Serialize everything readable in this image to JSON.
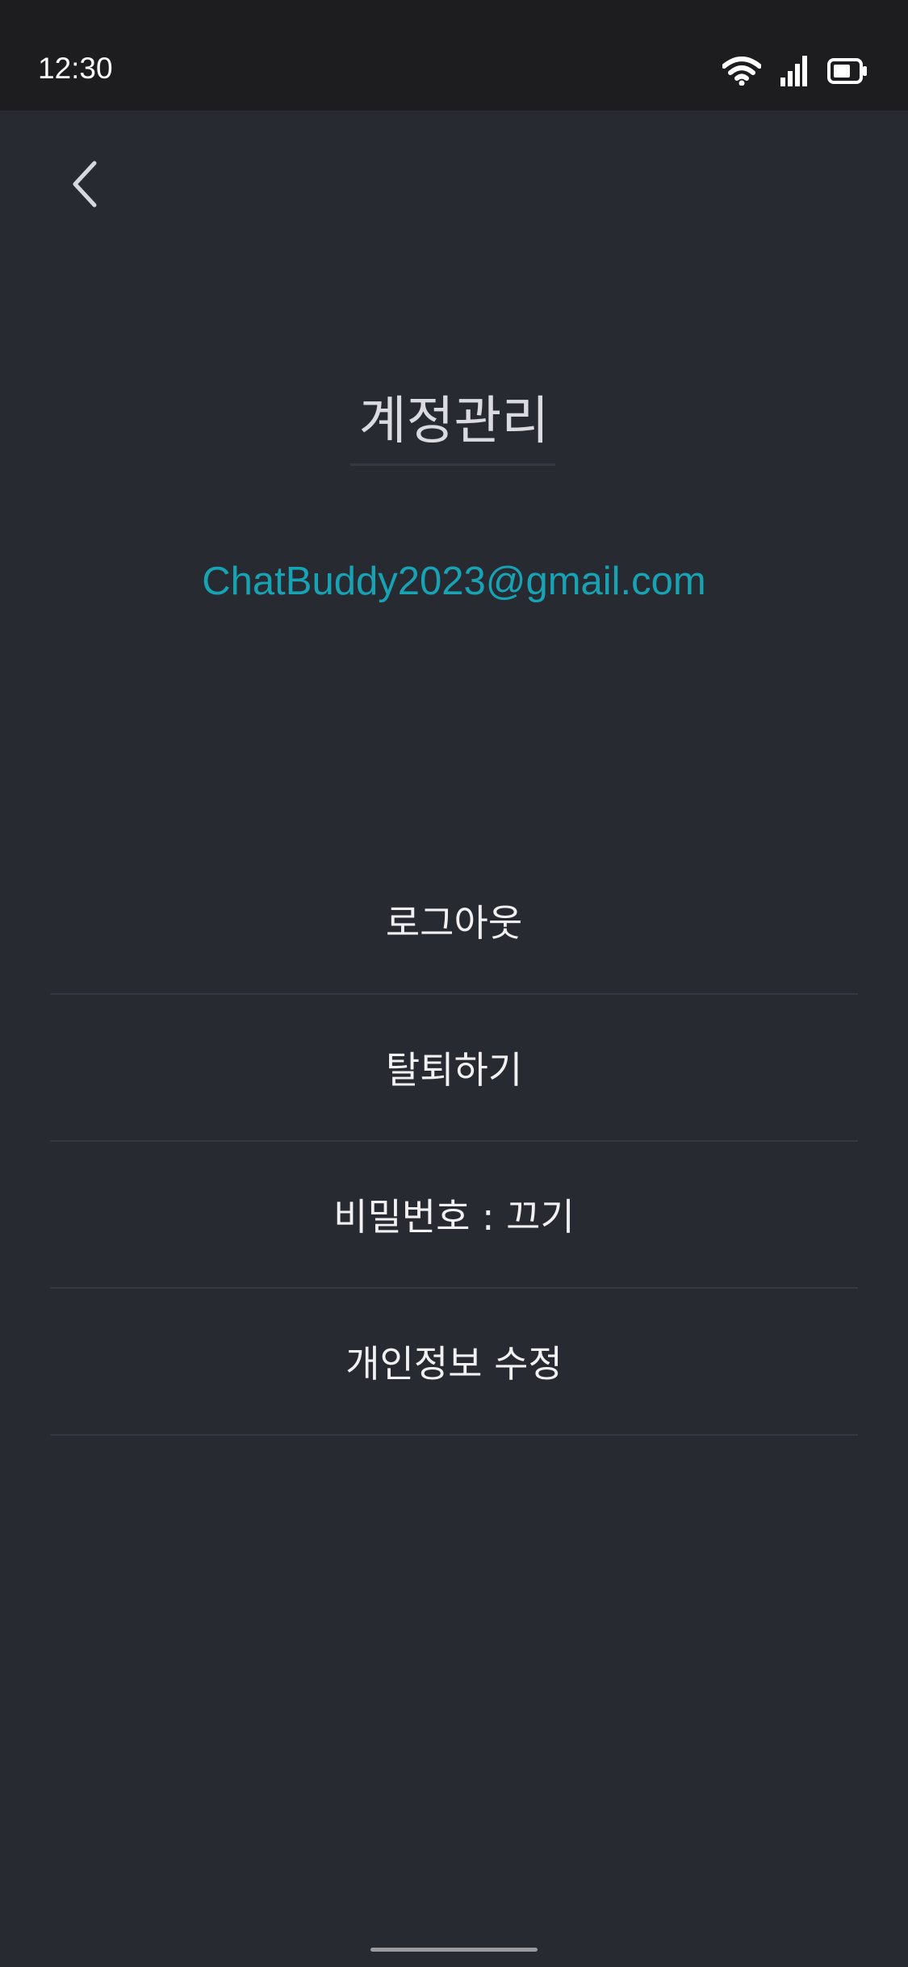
{
  "status_bar": {
    "time": "12:30",
    "icons": [
      "wifi-icon",
      "cellular-signal-icon",
      "battery-icon"
    ],
    "background": "#1d1d1f"
  },
  "header": {
    "back_icon": "chevron-left-icon",
    "title": "계정관리"
  },
  "account": {
    "email": "ChatBuddy2023@gmail.com"
  },
  "menu": {
    "items": [
      {
        "label": "로그아웃"
      },
      {
        "label": "탈퇴하기"
      },
      {
        "label": "비밀번호 : 끄기"
      },
      {
        "label": "개인정보 수정"
      }
    ]
  },
  "colors": {
    "background": "#282a32",
    "accent": "#17a3b3",
    "title_text": "#dadbe0",
    "menu_text": "#f1f1f4",
    "divider": "#353843"
  }
}
